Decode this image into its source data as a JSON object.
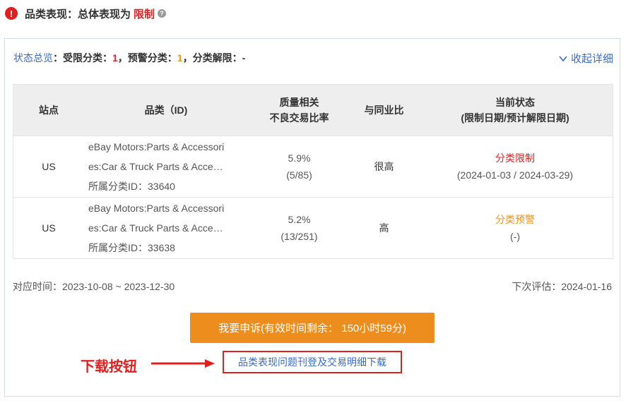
{
  "header": {
    "icon": "alert-icon",
    "title": "品类表现：总体表现为",
    "status": "限制",
    "help_icon": "question-icon"
  },
  "summary": {
    "label": "状态总览",
    "restricted_label": "受限分类：",
    "restricted_count": "1",
    "warning_label": "预警分类：",
    "warning_count": "1",
    "lifted_label": "分类解限：",
    "lifted_value": "-",
    "collapse_label": "收起详细"
  },
  "table": {
    "headers": {
      "site": "站点",
      "category": "品类（ID)",
      "ratio_line1": "质量相关",
      "ratio_line2": "不良交易比率",
      "peer": "与同业比",
      "status_line1": "当前状态",
      "status_line2": "(限制日期/预计解限日期)"
    },
    "rows": [
      {
        "site": "US",
        "cat_line1": "eBay Motors:Parts & Accessori",
        "cat_line2": "es:Car & Truck Parts & Acce…",
        "cat_id": "所属分类ID：33640",
        "ratio": "5.9%",
        "ratio_detail": "(5/85)",
        "peer": "很高",
        "status": "分类限制",
        "status_dates": "(2024-01-03 / 2024-03-29)"
      },
      {
        "site": "US",
        "cat_line1": "eBay Motors:Parts & Accessori",
        "cat_line2": "es:Car & Truck Parts & Acce…",
        "cat_id": "所属分类ID：33638",
        "ratio": "5.2%",
        "ratio_detail": "(13/251)",
        "peer": "高",
        "status": "分类预警",
        "status_dates": "(-)"
      }
    ]
  },
  "footer": {
    "period": "对应时间：2023-10-08 ~ 2023-12-30",
    "next_eval": "下次评估：2024-01-16"
  },
  "appeal_button": "我要申诉(有效时间剩余： 150小时59分)",
  "download_link": "品类表现问题刊登及交易明细下载",
  "annotation": "下载按钮",
  "colors": {
    "red": "#e02020",
    "orange": "#ec8d1e",
    "link": "#3a6bc4"
  }
}
